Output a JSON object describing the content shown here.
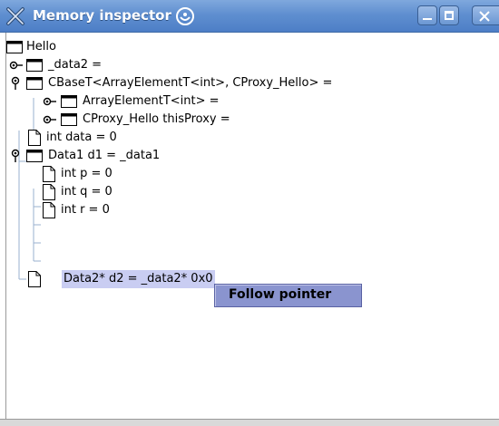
{
  "window": {
    "title": "Memory inspector"
  },
  "tree": [
    {
      "label": "Hello"
    },
    {
      "label": "_data2 ="
    },
    {
      "label": "CBaseT<ArrayElementT<int>, CProxy_Hello> ="
    },
    {
      "label": "ArrayElementT<int> ="
    },
    {
      "label": "CProxy_Hello thisProxy ="
    },
    {
      "label": "int data = 0"
    },
    {
      "label": "Data1 d1 = _data1"
    },
    {
      "label": "int p = 0"
    },
    {
      "label": "int q = 0"
    },
    {
      "label": "int r = 0"
    },
    {
      "label": "Data2* d2 = _data2* 0x0"
    }
  ],
  "context_menu": {
    "items": [
      {
        "label": "Follow pointer"
      }
    ]
  },
  "colors": {
    "titlebar": "#5f8fd0",
    "selection": "#c9cdf2",
    "menu": "#8a94cf"
  }
}
